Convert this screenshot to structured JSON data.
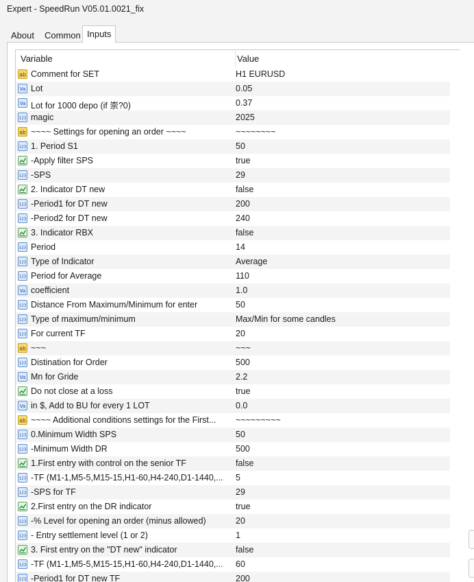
{
  "window": {
    "title": "Expert - SpeedRun V05.01.0021_fix"
  },
  "tabs": [
    {
      "label": "About",
      "active": false
    },
    {
      "label": "Common",
      "active": false
    },
    {
      "label": "Inputs",
      "active": true
    }
  ],
  "columns": {
    "variable": "Variable",
    "value": "Value"
  },
  "icon_types": {
    "ab": "string-icon",
    "va": "double-icon",
    "123": "integer-icon",
    "bool": "boolean-icon"
  },
  "colors": {
    "accent_blue": "#1f6fc5",
    "string_yellow": "#e8b21c",
    "bool_green": "#2e9b3a"
  },
  "rows": [
    {
      "type": "ab",
      "variable": "Comment for SET",
      "value": "H1 EURUSD"
    },
    {
      "type": "va",
      "variable": "Lot",
      "value": "0.05"
    },
    {
      "type": "va",
      "variable": "Lot for 1000 depo (if 崇?0)",
      "value": "0.37"
    },
    {
      "type": "123",
      "variable": "magic",
      "value": "2025"
    },
    {
      "type": "ab",
      "variable": "~~~~ Settings for opening an order ~~~~",
      "value": "~~~~~~~~"
    },
    {
      "type": "123",
      "variable": "1. Period S1",
      "value": "50"
    },
    {
      "type": "bool",
      "variable": "-Apply filter SPS",
      "value": "true"
    },
    {
      "type": "123",
      "variable": "-SPS",
      "value": "29"
    },
    {
      "type": "bool",
      "variable": "2. Indicator DT new",
      "value": "false"
    },
    {
      "type": "123",
      "variable": "-Period1 for DT new",
      "value": "200"
    },
    {
      "type": "123",
      "variable": "-Period2 for DT new",
      "value": "240"
    },
    {
      "type": "bool",
      "variable": "3. Indicator RBX",
      "value": "false"
    },
    {
      "type": "123",
      "variable": "Period",
      "value": "14"
    },
    {
      "type": "123",
      "variable": "Type of Indicator",
      "value": "Average"
    },
    {
      "type": "123",
      "variable": "Period for Average",
      "value": "110"
    },
    {
      "type": "va",
      "variable": "coefficient",
      "value": "1.0"
    },
    {
      "type": "123",
      "variable": "Distance From Maximum/Minimum for enter",
      "value": "50"
    },
    {
      "type": "123",
      "variable": "Type of maximum/minimum",
      "value": "Max/Min for some candles"
    },
    {
      "type": "123",
      "variable": "For current TF",
      "value": "20"
    },
    {
      "type": "ab",
      "variable": "~~~",
      "value": "~~~"
    },
    {
      "type": "123",
      "variable": "Distination for Order",
      "value": "500"
    },
    {
      "type": "va",
      "variable": "Mn for Gride",
      "value": "2.2"
    },
    {
      "type": "bool",
      "variable": "Do not close at a loss",
      "value": "true"
    },
    {
      "type": "va",
      "variable": "in $, Add to BU for every 1 LOT",
      "value": "0.0"
    },
    {
      "type": "ab",
      "variable": "~~~~ Additional conditions settings for the First...",
      "value": "~~~~~~~~~"
    },
    {
      "type": "123",
      "variable": "0.Minimum Width SPS",
      "value": "50"
    },
    {
      "type": "123",
      "variable": "-Minimum Width DR",
      "value": "500"
    },
    {
      "type": "bool",
      "variable": "1.First entry with control on the senior TF",
      "value": "false"
    },
    {
      "type": "123",
      "variable": "-TF (M1-1,M5-5,M15-15,H1-60,H4-240,D1-1440,...",
      "value": "5"
    },
    {
      "type": "123",
      "variable": "-SPS for TF",
      "value": "29"
    },
    {
      "type": "bool",
      "variable": "2.First entry on the DR indicator",
      "value": "true"
    },
    {
      "type": "123",
      "variable": "-% Level for opening an order (minus allowed)",
      "value": "20"
    },
    {
      "type": "123",
      "variable": "- Entry settlement level (1 or 2)",
      "value": "1"
    },
    {
      "type": "bool",
      "variable": "3. First entry on the \"DT new\" indicator",
      "value": "false"
    },
    {
      "type": "123",
      "variable": "-TF (M1-1,M5-5,M15-15,H1-60,H4-240,D1-1440,...",
      "value": "60"
    },
    {
      "type": "123",
      "variable": "-Period1 for DT new TF",
      "value": "200"
    }
  ]
}
